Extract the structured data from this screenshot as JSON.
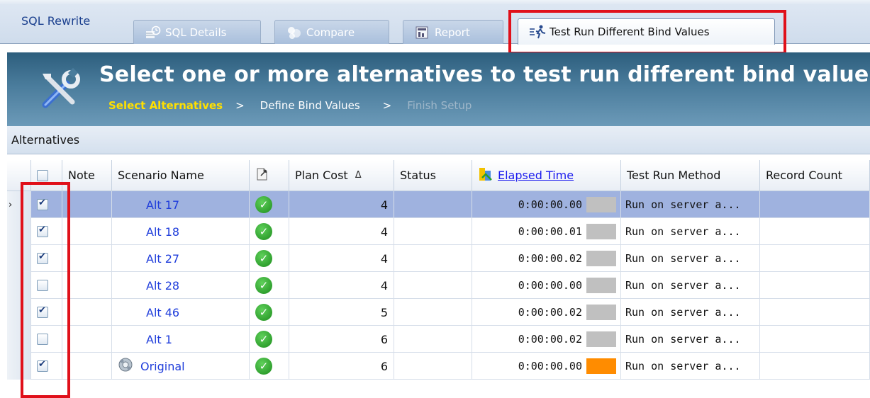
{
  "app": {
    "title": "SQL Rewrite"
  },
  "tabs": [
    {
      "label": "SQL Details",
      "icon": "sql-details-icon"
    },
    {
      "label": "Compare",
      "icon": "compare-icon"
    },
    {
      "label": "Report",
      "icon": "report-icon"
    },
    {
      "label": "Test Run Different Bind Values",
      "icon": "test-run-icon",
      "active": true
    }
  ],
  "banner": {
    "title": "Select one or more alternatives to test run different bind values",
    "steps": [
      {
        "label": "Select Alternatives",
        "state": "current"
      },
      {
        "label": "Define Bind Values",
        "state": "next"
      },
      {
        "label": "Finish Setup",
        "state": "disabled"
      }
    ],
    "separator": ">"
  },
  "section": {
    "label": "Alternatives"
  },
  "grid": {
    "columns": {
      "note": "Note",
      "scenario": "Scenario Name",
      "plan_cost": "Plan Cost",
      "sort_indicator": "Δ",
      "status": "Status",
      "elapsed": "Elapsed Time",
      "method": "Test Run Method",
      "record_count": "Record Count"
    },
    "rows": [
      {
        "checked": true,
        "selected": true,
        "scenario": "Alt 17",
        "plan_cost": "4",
        "elapsed": "0:00:00.00",
        "bar_color": "#c0c0c0",
        "method": "Run on server a..."
      },
      {
        "checked": true,
        "selected": false,
        "scenario": "Alt 18",
        "plan_cost": "4",
        "elapsed": "0:00:00.01",
        "bar_color": "#c0c0c0",
        "method": "Run on server a..."
      },
      {
        "checked": true,
        "selected": false,
        "scenario": "Alt 27",
        "plan_cost": "4",
        "elapsed": "0:00:00.02",
        "bar_color": "#c0c0c0",
        "method": "Run on server a..."
      },
      {
        "checked": false,
        "selected": false,
        "scenario": "Alt 28",
        "plan_cost": "4",
        "elapsed": "0:00:00.00",
        "bar_color": "#c0c0c0",
        "method": "Run on server a..."
      },
      {
        "checked": true,
        "selected": false,
        "scenario": "Alt 46",
        "plan_cost": "5",
        "elapsed": "0:00:00.02",
        "bar_color": "#c0c0c0",
        "method": "Run on server a..."
      },
      {
        "checked": false,
        "selected": false,
        "scenario": "Alt 1",
        "plan_cost": "6",
        "elapsed": "0:00:00.02",
        "bar_color": "#c0c0c0",
        "method": "Run on server a..."
      },
      {
        "checked": true,
        "selected": false,
        "scenario": "Original",
        "original": true,
        "plan_cost": "6",
        "elapsed": "0:00:00.00",
        "bar_color": "#ff8c00",
        "method": "Run on server a..."
      }
    ]
  },
  "colors": {
    "highlight": "#e0101a",
    "banner": "#3f7191",
    "link": "#1f3ddb",
    "step_current": "#ffe000"
  }
}
